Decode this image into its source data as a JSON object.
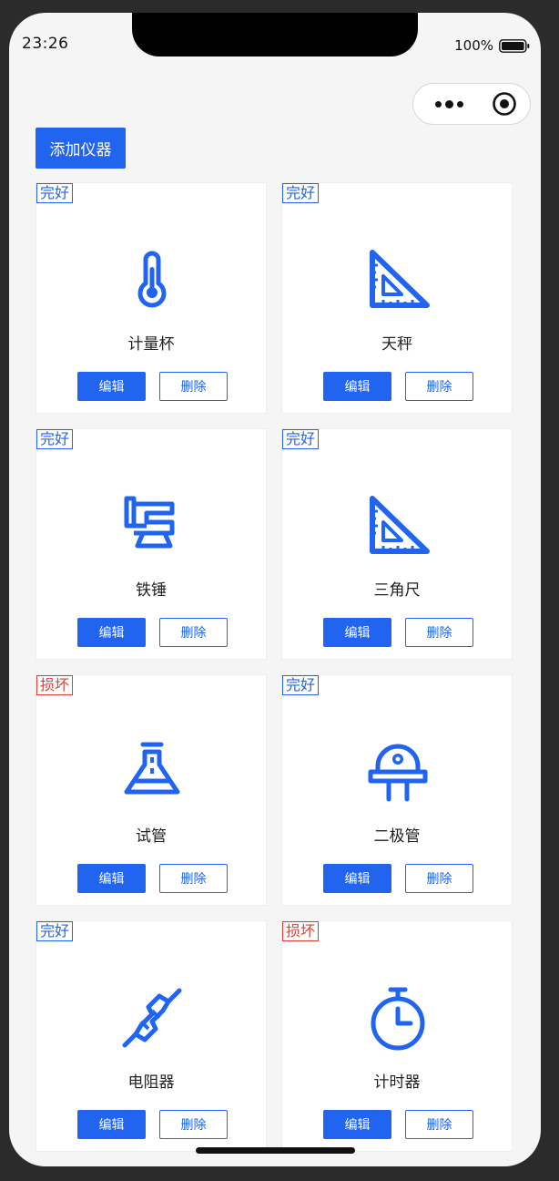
{
  "status": {
    "time": "23:26",
    "battery": "100%"
  },
  "capsule": {
    "menu_icon": "more-dots-icon",
    "close_icon": "target-icon"
  },
  "toolbar": {
    "add_label": "添加仪器"
  },
  "colors": {
    "primary": "#2064f0",
    "danger": "#e43b30",
    "background": "#f5f5f5"
  },
  "instruments": [
    {
      "status": "完好",
      "state": "ok",
      "name": "计量杯",
      "icon": "thermometer-icon",
      "edit_label": "编辑",
      "delete_label": "删除"
    },
    {
      "status": "完好",
      "state": "ok",
      "name": "天秤",
      "icon": "set-square-icon",
      "edit_label": "编辑",
      "delete_label": "删除"
    },
    {
      "status": "完好",
      "state": "ok",
      "name": "铁锤",
      "icon": "vise-icon",
      "edit_label": "编辑",
      "delete_label": "删除"
    },
    {
      "status": "完好",
      "state": "ok",
      "name": "三角尺",
      "icon": "set-square-icon",
      "edit_label": "编辑",
      "delete_label": "删除"
    },
    {
      "status": "损坏",
      "state": "bad",
      "name": "试管",
      "icon": "flask-icon",
      "edit_label": "编辑",
      "delete_label": "删除"
    },
    {
      "status": "完好",
      "state": "ok",
      "name": "二极管",
      "icon": "diode-icon",
      "edit_label": "编辑",
      "delete_label": "删除"
    },
    {
      "status": "完好",
      "state": "ok",
      "name": "电阻器",
      "icon": "resistor-icon",
      "edit_label": "编辑",
      "delete_label": "删除"
    },
    {
      "status": "损坏",
      "state": "bad",
      "name": "计时器",
      "icon": "stopwatch-icon",
      "edit_label": "编辑",
      "delete_label": "删除"
    }
  ]
}
